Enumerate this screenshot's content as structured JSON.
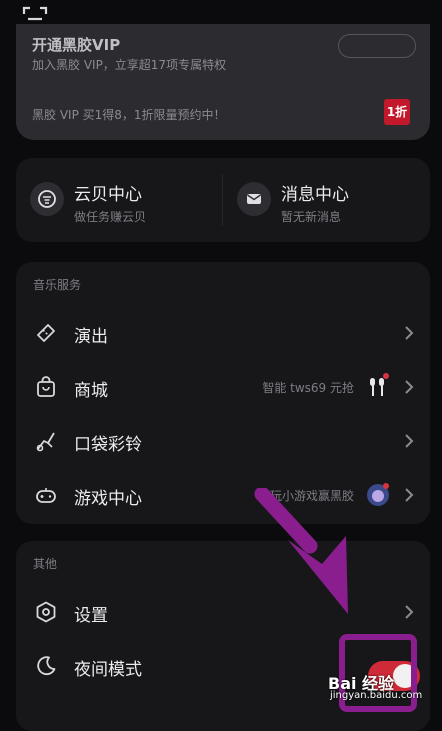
{
  "header": {
    "scan_icon": "scan-icon"
  },
  "vip_card": {
    "title": "开通黑胶VIP",
    "subtitle": "加入黑胶 VIP，立享超17项专属特权",
    "promo": "黑胶 VIP 买1得8，1折限量预约中！",
    "badge": "1折"
  },
  "quick_cards": [
    {
      "title": "云贝中心",
      "subtitle": "做任务赚云贝",
      "icon": "coin-icon"
    },
    {
      "title": "消息中心",
      "subtitle": "暂无新消息",
      "icon": "mail-icon"
    }
  ],
  "music_services": {
    "header": "音乐服务",
    "items": [
      {
        "label": "演出",
        "extra": "",
        "icon": "ticket-icon"
      },
      {
        "label": "商城",
        "extra": "智能 tws69 元抢",
        "icon": "shopping-bag-icon"
      },
      {
        "label": "口袋彩铃",
        "extra": "",
        "icon": "music-note-icon"
      },
      {
        "label": "游戏中心",
        "extra": "玩小游戏赢黑胶",
        "icon": "gamepad-icon"
      }
    ]
  },
  "other": {
    "header": "其他",
    "items": [
      {
        "label": "设置",
        "icon": "settings-icon"
      },
      {
        "label": "夜间模式",
        "icon": "moon-icon",
        "toggle_on": true
      }
    ]
  },
  "watermark": {
    "text": "Bai 经验",
    "sub": "jingyan.baidu.com"
  },
  "colors": {
    "accent_red": "#cf2a38",
    "annotation_purple": "#8a1e8e",
    "background": "#0b0b0d",
    "card": "#17171a"
  }
}
